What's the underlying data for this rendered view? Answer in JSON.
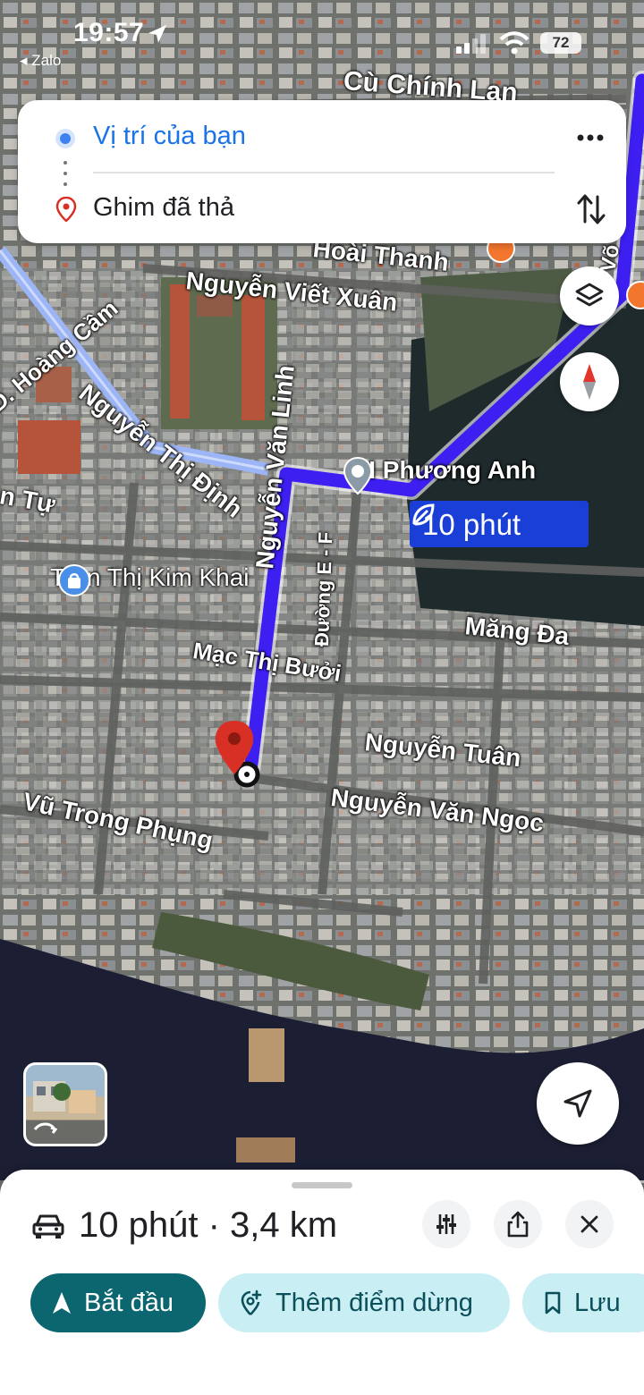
{
  "status_bar": {
    "time": "19:57",
    "back_app": "Zalo",
    "battery": "72"
  },
  "route": {
    "origin": "Vị trí của bạn",
    "destination": "Ghim đã thả"
  },
  "map": {
    "streets": [
      "Cù Chính Lan",
      "Nguyễn Viết Xuân",
      "D. Hoàng Cầm",
      "Nguyễn Thị Định",
      "Nguyễn Văn Linh",
      "Đường E - F",
      "Măng Đa",
      "Mạc Thị Bưởi",
      "Nguyễn Tuân",
      "Nguyễn Văn Ngọc",
      "Vũ Trọng Phụng",
      "Hoài Thanh",
      "n Tự",
      "Võ"
    ],
    "pois": {
      "phuong_anh": "DI Phương Anh",
      "kim_khai": "Trần Thị Kim Khai"
    },
    "eta_label": "10 phút",
    "route_color": "#3d1ff2"
  },
  "sheet": {
    "summary": "10 phút · 3,4 km",
    "start_label": "Bắt đầu",
    "add_stop_label": "Thêm điểm dừng",
    "save_label": "Lưu"
  },
  "colors": {
    "accent_teal": "#0b6670",
    "light_teal": "#c9eef4",
    "link_blue": "#1a73e8",
    "pin_red": "#d93025"
  }
}
